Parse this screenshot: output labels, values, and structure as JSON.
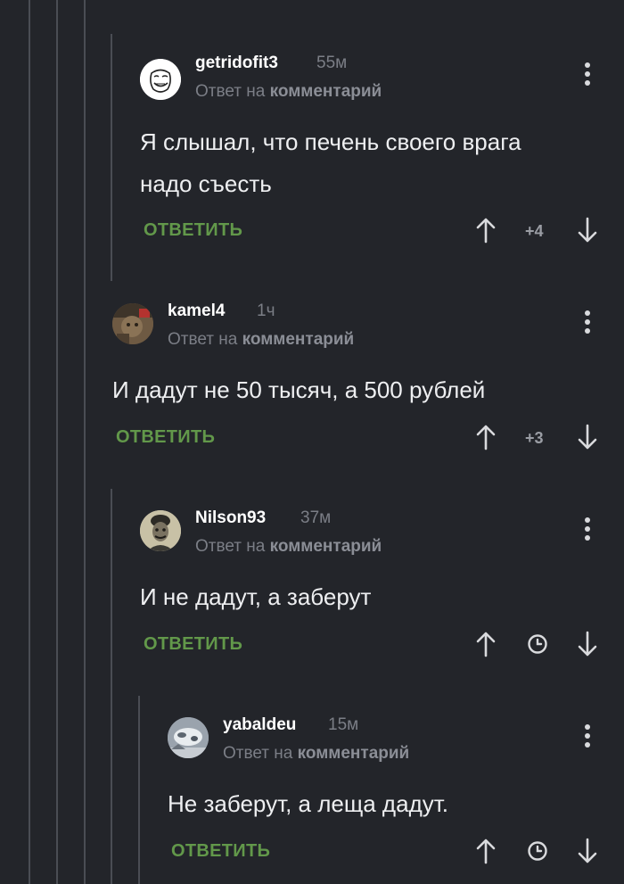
{
  "comments": [
    {
      "username": "getridofit3",
      "time": "55м",
      "reply_prefix": "Ответ на",
      "reply_target": "комментарий",
      "lines": [
        "Я слышал, что печень своего врага",
        "надо съесть"
      ],
      "reply_label": "ОТВЕТИТЬ",
      "score": "+4",
      "avatar": "trollface-avatar"
    },
    {
      "username": "kamel4",
      "time": "1ч",
      "reply_prefix": "Ответ на",
      "reply_target": "комментарий",
      "lines": [
        "И дадут не 50 тысяч, а 500 рублей"
      ],
      "reply_label": "ОТВЕТИТЬ",
      "score": "+3",
      "avatar": "photo-avatar"
    },
    {
      "username": "Nilson93",
      "time": "37м",
      "reply_prefix": "Ответ на",
      "reply_target": "комментарий",
      "lines": [
        "И не дадут, а заберут"
      ],
      "reply_label": "ОТВЕТИТЬ",
      "score": null,
      "avatar": "portrait-avatar"
    },
    {
      "username": "yabaldeu",
      "time": "15м",
      "reply_prefix": "Ответ на",
      "reply_target": "комментарий",
      "lines": [
        "Не заберут, а леща дадут."
      ],
      "reply_label": "ОТВЕТИТЬ",
      "score": null,
      "avatar": "snow-avatar"
    }
  ],
  "colors": {
    "background": "#23252a",
    "thread_line": "#4a4d54",
    "reply_button": "#62984a",
    "muted_text": "#7b7e86"
  },
  "icons": {
    "upvote": "arrow-up-icon",
    "downvote": "arrow-down-icon",
    "pending_score": "clock-icon",
    "menu": "more-vertical-icon"
  }
}
